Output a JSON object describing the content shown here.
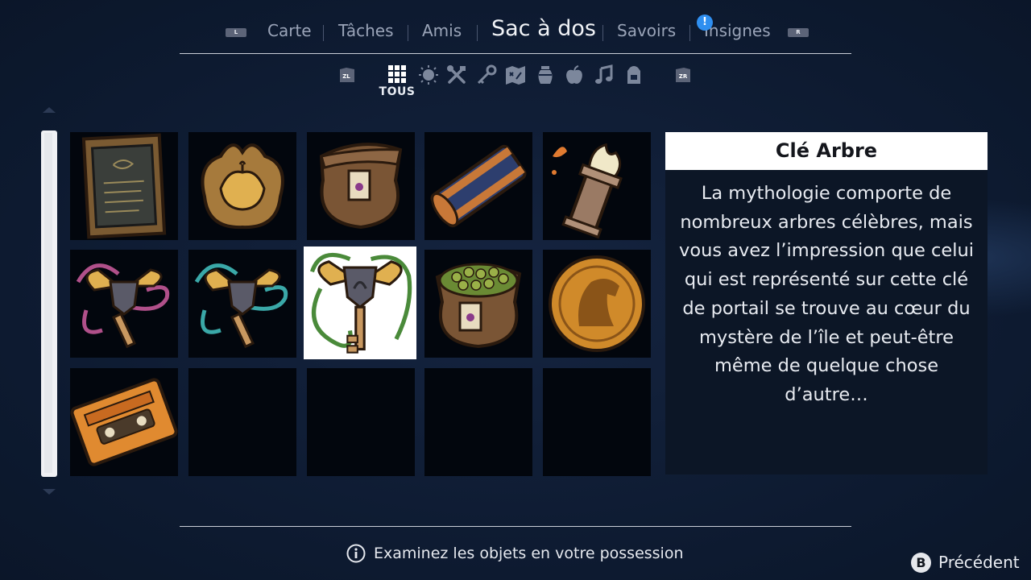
{
  "top_tabs": {
    "left_button": "L",
    "right_button": "R",
    "items": [
      {
        "label": "Carte"
      },
      {
        "label": "Tâches"
      },
      {
        "label": "Amis"
      },
      {
        "label": "Sac à dos",
        "active": true
      },
      {
        "label": "Savoirs"
      },
      {
        "label": "Insignes",
        "notification": "!"
      }
    ]
  },
  "categories": {
    "left_button": "ZL",
    "right_button": "ZR",
    "selected_label": "TOUS",
    "icons": [
      "grid-icon",
      "sun-icon",
      "tools-icon",
      "key-icon",
      "map-icon",
      "jar-icon",
      "apple-icon",
      "music-note-icon",
      "backpack-icon"
    ]
  },
  "inventory": {
    "items": [
      {
        "name": "framed-tapestry"
      },
      {
        "name": "golden-flower"
      },
      {
        "name": "seed-sack"
      },
      {
        "name": "rolled-rug"
      },
      {
        "name": "torch-pillar"
      },
      {
        "name": "pink-winged-key"
      },
      {
        "name": "teal-winged-key"
      },
      {
        "name": "green-winged-key",
        "selected": true
      },
      {
        "name": "pea-sack"
      },
      {
        "name": "golden-horse-coin"
      },
      {
        "name": "orange-cassette"
      },
      {
        "name": "empty"
      },
      {
        "name": "empty"
      },
      {
        "name": "empty"
      },
      {
        "name": "empty"
      }
    ]
  },
  "detail": {
    "title": "Clé Arbre",
    "description": "La mythologie comporte de nombreux arbres célèbres, mais vous avez l’impression que celui qui est représenté sur cette clé de portail se trouve au cœur du mystère de l’île et peut-être même de quelque chose d’autre…"
  },
  "footer": {
    "info_text": "Examinez les objets en votre possession",
    "back_button": "B",
    "back_label": "Précédent"
  },
  "colors": {
    "background": "#0d1a30",
    "accent_notification": "#2f8ff0",
    "panel_title_bg": "#ffffff",
    "panel_body_bg": "#0c1626"
  }
}
